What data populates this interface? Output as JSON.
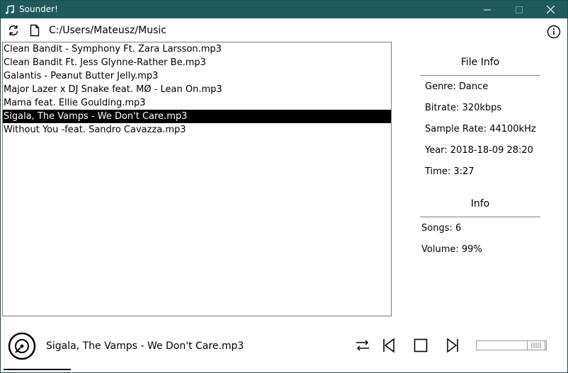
{
  "window": {
    "title": "Sounder!",
    "colors": {
      "titlebar": "#1f5a5c",
      "selection": "#000000"
    },
    "controls": [
      "minimize-icon",
      "maximize-icon",
      "close-icon"
    ]
  },
  "toolbar": {
    "path": "C:/Users/Mateusz/Music",
    "icons": [
      "refresh-icon",
      "file-icon",
      "info-icon"
    ]
  },
  "files": [
    {
      "name": "Clean Bandit - Symphony Ft. Zara Larsson.mp3",
      "selected": false
    },
    {
      "name": "Clean Bandit Ft. Jess Glynne-Rather Be.mp3",
      "selected": false
    },
    {
      "name": "Galantis - Peanut Butter Jelly.mp3",
      "selected": false
    },
    {
      "name": "Major Lazer x DJ Snake feat. MØ - Lean On.mp3",
      "selected": false
    },
    {
      "name": "Mama feat. Ellie Goulding.mp3",
      "selected": false
    },
    {
      "name": "Sigala, The Vamps - We Don't Care.mp3",
      "selected": true
    },
    {
      "name": "Without You -feat. Sandro Cavazza.mp3",
      "selected": false
    }
  ],
  "file_info": {
    "heading": "File Info",
    "genre": "Genre: Dance",
    "bitrate": "Bitrate: 320kbps",
    "sample_rate": "Sample Rate: 44100kHz",
    "year": "Year: 2018-18-09 28:20",
    "time": "Time: 3:27"
  },
  "info": {
    "heading": "Info",
    "songs": "Songs: 6",
    "volume": "Volume: 99%"
  },
  "player": {
    "now_playing": "Sigala, The Vamps - We Don't Care.mp3",
    "progress": 0.12,
    "volume_level": 0.99,
    "icons": [
      "disc-icon",
      "shuffle-icon",
      "previous-icon",
      "stop-icon",
      "next-icon"
    ]
  }
}
